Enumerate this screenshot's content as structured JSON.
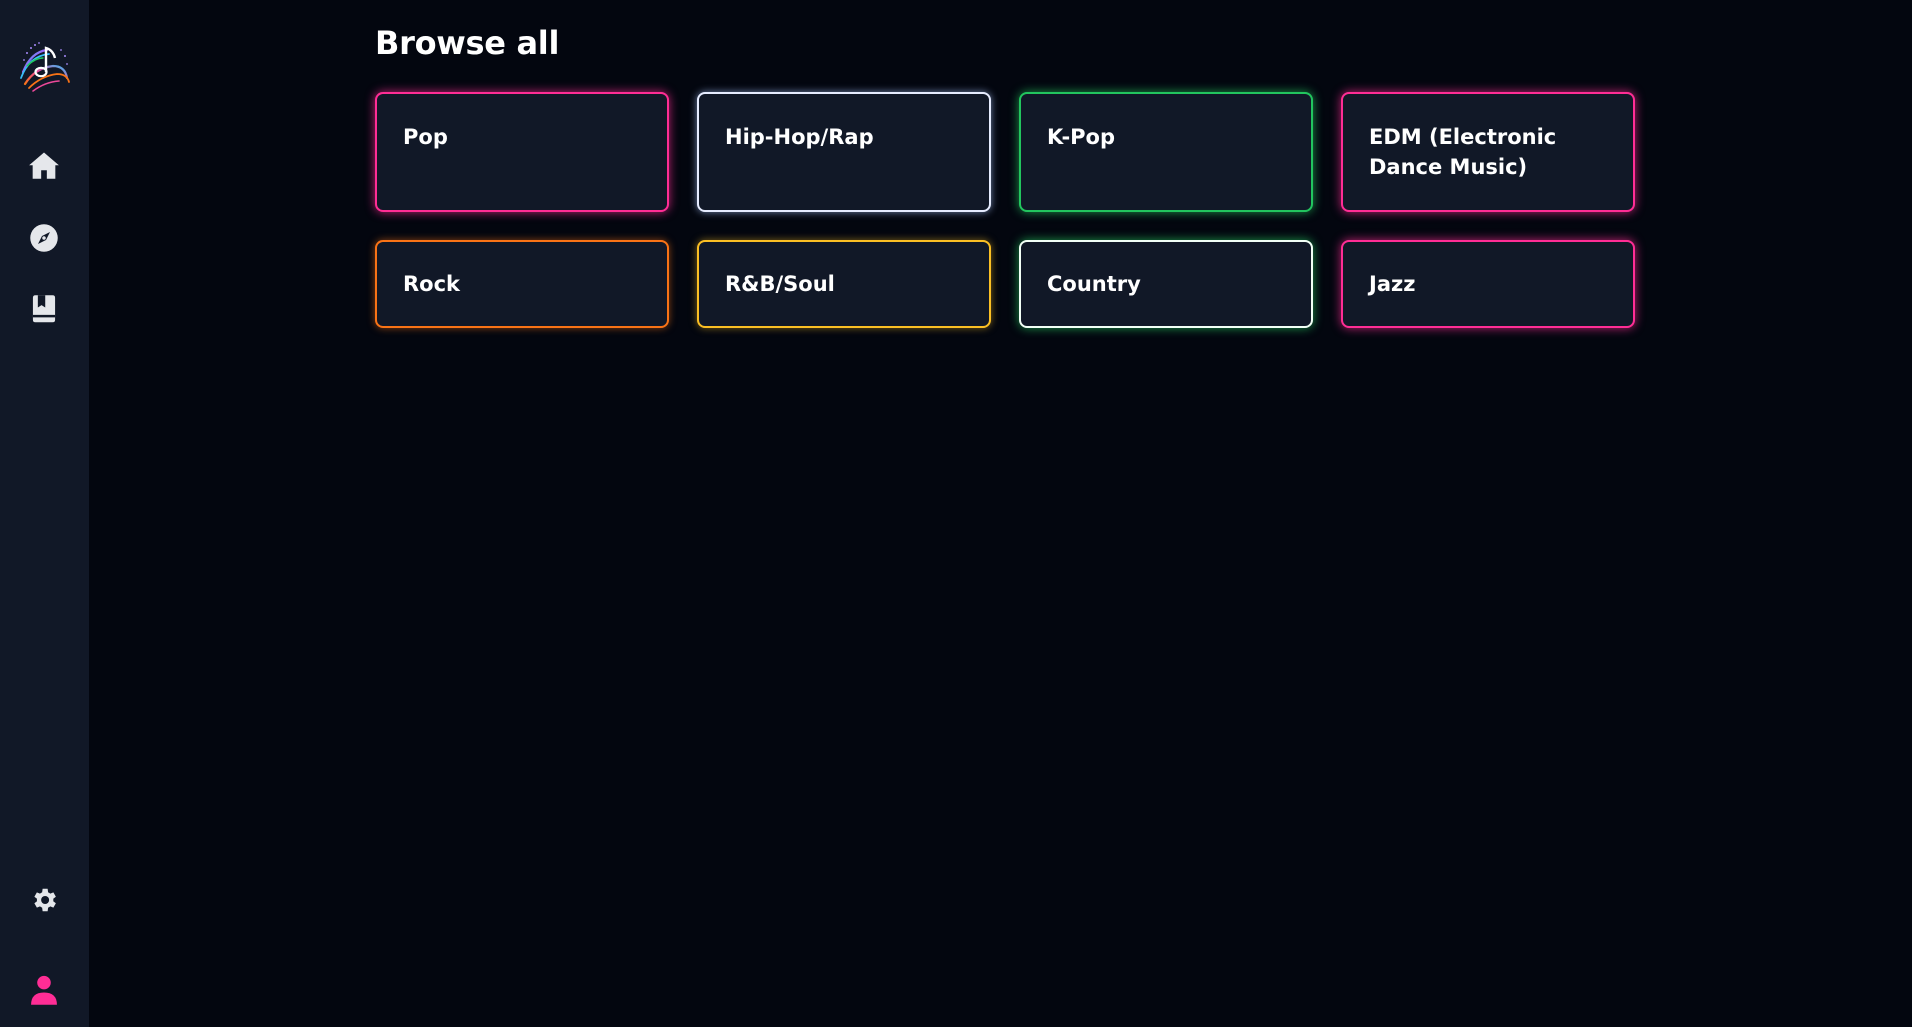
{
  "sidebar": {
    "logo_icon": "music-note-logo-icon",
    "nav": [
      {
        "icon": "home-icon"
      },
      {
        "icon": "compass-icon"
      },
      {
        "icon": "library-icon"
      }
    ],
    "settings_icon": "gear-icon",
    "profile_icon": "user-icon",
    "colors": {
      "background": "#111827",
      "icon": "#e5e7eb",
      "profile": "#ff2d95"
    }
  },
  "main": {
    "title": "Browse all",
    "genres": [
      {
        "label": "Pop",
        "color": "#ff2d95"
      },
      {
        "label": "Hip-Hop/Rap",
        "color": "#e6ecff"
      },
      {
        "label": "K-Pop",
        "color": "#22c55e"
      },
      {
        "label": "EDM (Electronic Dance Music)",
        "color": "#ff2d95"
      },
      {
        "label": "Rock",
        "color": "#f97316"
      },
      {
        "label": "R&B/Soul",
        "color": "#fbbf24"
      },
      {
        "label": "Country",
        "color": "#f2fff6"
      },
      {
        "label": "Jazz",
        "color": "#ff2d95"
      }
    ]
  },
  "colors": {
    "page_background": "#03060f",
    "card_background": "#111827"
  }
}
